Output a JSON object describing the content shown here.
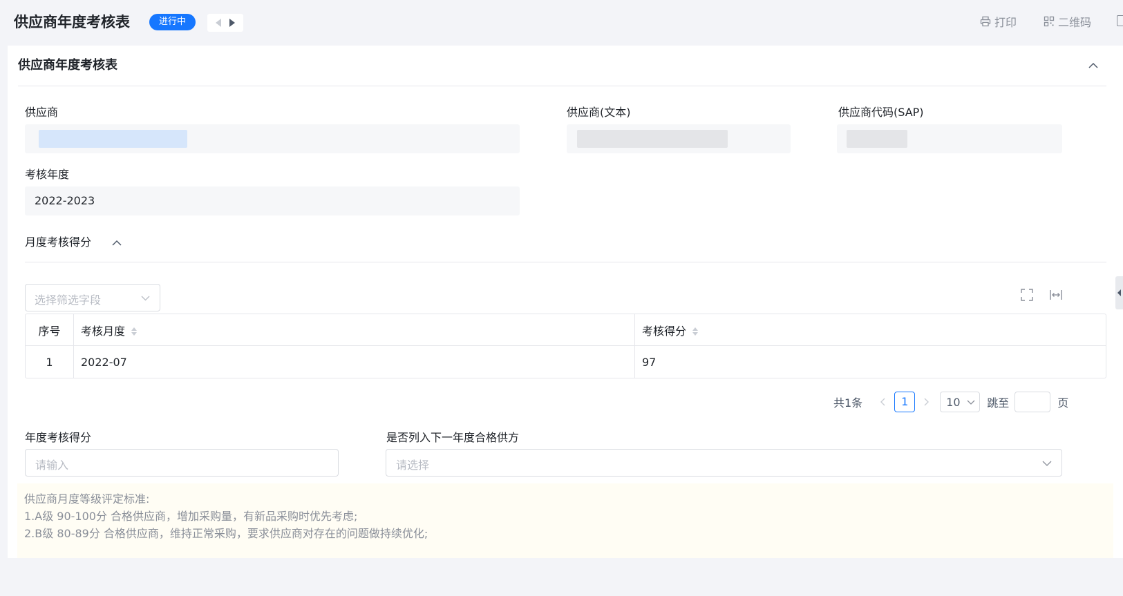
{
  "header": {
    "title": "供应商年度考核表",
    "status": "进行中",
    "print_label": "打印",
    "qr_label": "二维码"
  },
  "section": {
    "title": "供应商年度考核表"
  },
  "fields": {
    "supplier": {
      "label": "供应商",
      "value": ""
    },
    "supplier_text": {
      "label": "供应商(文本)",
      "value": ""
    },
    "supplier_code": {
      "label": "供应商代码(SAP)",
      "value": ""
    },
    "year": {
      "label": "考核年度",
      "value": "2022-2023"
    }
  },
  "monthly": {
    "title": "月度考核得分",
    "filter_placeholder": "选择筛选字段",
    "columns": [
      "序号",
      "考核月度",
      "考核得分"
    ],
    "rows": [
      {
        "index": "1",
        "month": "2022-07",
        "score": "97"
      }
    ]
  },
  "pagination": {
    "total": "共1条",
    "current_page": "1",
    "page_size": "10",
    "jump_label": "跳至",
    "page_unit": "页"
  },
  "annual": {
    "score_label": "年度考核得分",
    "score_placeholder": "请输入",
    "qualified_label": "是否列入下一年度合格供方",
    "qualified_placeholder": "请选择"
  },
  "notice": {
    "lines": [
      "供应商月度等级评定标准:",
      "1.A级 90-100分 合格供应商，增加采购量，有新品采购时优先考虑;",
      "2.B级 80-89分 合格供应商，维持正常采购，要求供应商对存在的问题做持续优化;"
    ]
  },
  "colors": {
    "accent": "#1677ff",
    "blur_blue": "#d6e6fb",
    "blur_gray": "#e4e5e8"
  }
}
